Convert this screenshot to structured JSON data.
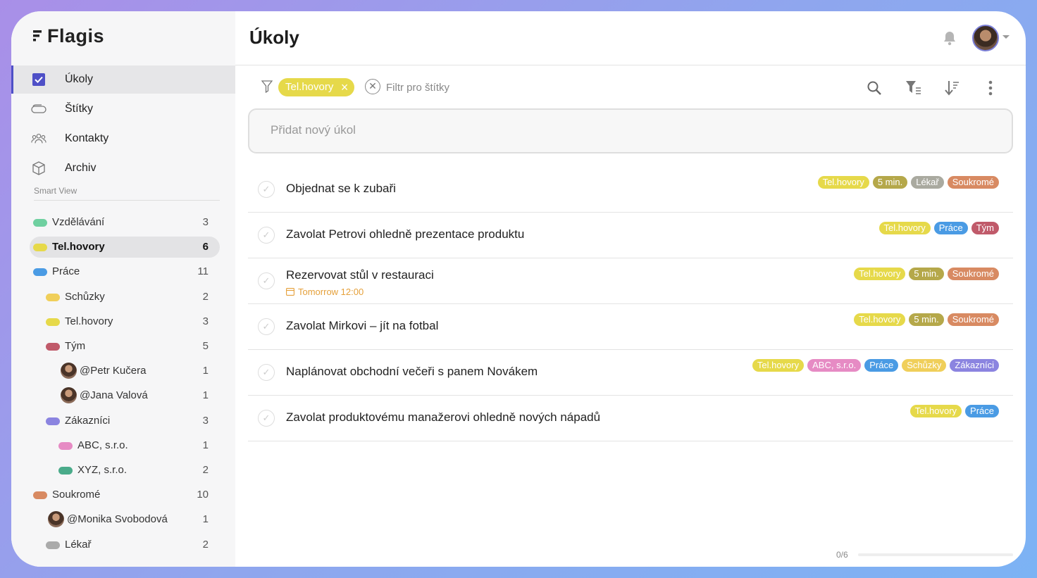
{
  "app": {
    "name": "Flagis"
  },
  "nav": [
    {
      "label": "Úkoly",
      "icon": "checkbox-icon",
      "active": true
    },
    {
      "label": "Štítky",
      "icon": "tag-icon",
      "active": false
    },
    {
      "label": "Kontakty",
      "icon": "contacts-icon",
      "active": false
    },
    {
      "label": "Archiv",
      "icon": "archive-icon",
      "active": false
    }
  ],
  "smart_view": {
    "title": "Smart View",
    "items": [
      {
        "name": "Vzdělávání",
        "count": "3",
        "color": "#6fd0a0",
        "indent": 0
      },
      {
        "name": "Tel.hovory",
        "count": "6",
        "color": "#e6d94a",
        "indent": 0,
        "active": true
      },
      {
        "name": "Práce",
        "count": "11",
        "color": "#4a9be4",
        "indent": 0
      },
      {
        "name": "Schůzky",
        "count": "2",
        "color": "#f0cf5a",
        "indent": 1
      },
      {
        "name": "Tel.hovory",
        "count": "3",
        "color": "#e6d94a",
        "indent": 1
      },
      {
        "name": "Tým",
        "count": "5",
        "color": "#c05a6a",
        "indent": 1
      },
      {
        "name": "@Petr Kučera",
        "count": "1",
        "avatar": true,
        "indent": 2
      },
      {
        "name": "@Jana Valová",
        "count": "1",
        "avatar": true,
        "indent": 2
      },
      {
        "name": "Zákazníci",
        "count": "3",
        "color": "#8b84e0",
        "indent": 1
      },
      {
        "name": "ABC, s.r.o.",
        "count": "1",
        "color": "#e68bc4",
        "indent": 2
      },
      {
        "name": "XYZ, s.r.o.",
        "count": "2",
        "color": "#4aab8a",
        "indent": 2
      },
      {
        "name": "Soukromé",
        "count": "10",
        "color": "#d88a62",
        "indent": 0
      },
      {
        "name": "@Monika Svobodová",
        "count": "1",
        "avatar": true,
        "indent": 1
      },
      {
        "name": "Lékař",
        "count": "2",
        "color": "#aaaaaa",
        "indent": 1
      }
    ]
  },
  "header": {
    "title": "Úkoly"
  },
  "filter": {
    "active_chip": "Tel.hovory",
    "hint": "Filtr pro štítky"
  },
  "new_task": {
    "placeholder": "Přidat nový úkol"
  },
  "tag_colors": {
    "Tel.hovory": "#e6d94a",
    "5 min.": "#b5a84a",
    "Lékař": "#aaaaa0",
    "Soukromé": "#d88a62",
    "Práce": "#4a9be4",
    "Tým": "#c05a6a",
    "ABC, s.r.o.": "#e68bc4",
    "Schůzky": "#f0cf5a",
    "Zákazníci": "#8b84e0"
  },
  "tasks": [
    {
      "title": "Objednat se k zubaři",
      "tags": [
        "Tel.hovory",
        "5 min.",
        "Lékař",
        "Soukromé"
      ]
    },
    {
      "title": "Zavolat Petrovi ohledně prezentace produktu",
      "tags": [
        "Tel.hovory",
        "Práce",
        "Tým"
      ]
    },
    {
      "title": "Rezervovat stůl v restauraci",
      "date": "Tomorrow 12:00",
      "tags": [
        "Tel.hovory",
        "5 min.",
        "Soukromé"
      ]
    },
    {
      "title": "Zavolat Mirkovi – jít na fotbal",
      "tags": [
        "Tel.hovory",
        "5 min.",
        "Soukromé"
      ]
    },
    {
      "title": "Naplánovat obchodní večeři s panem Novákem",
      "tags": [
        "Tel.hovory",
        "ABC, s.r.o.",
        "Práce",
        "Schůzky",
        "Zákazníci"
      ]
    },
    {
      "title": "Zavolat produktovému manažerovi ohledně nových nápadů",
      "tags": [
        "Tel.hovory",
        "Práce"
      ]
    }
  ],
  "progress": {
    "label": "0/6",
    "fraction": 0
  }
}
